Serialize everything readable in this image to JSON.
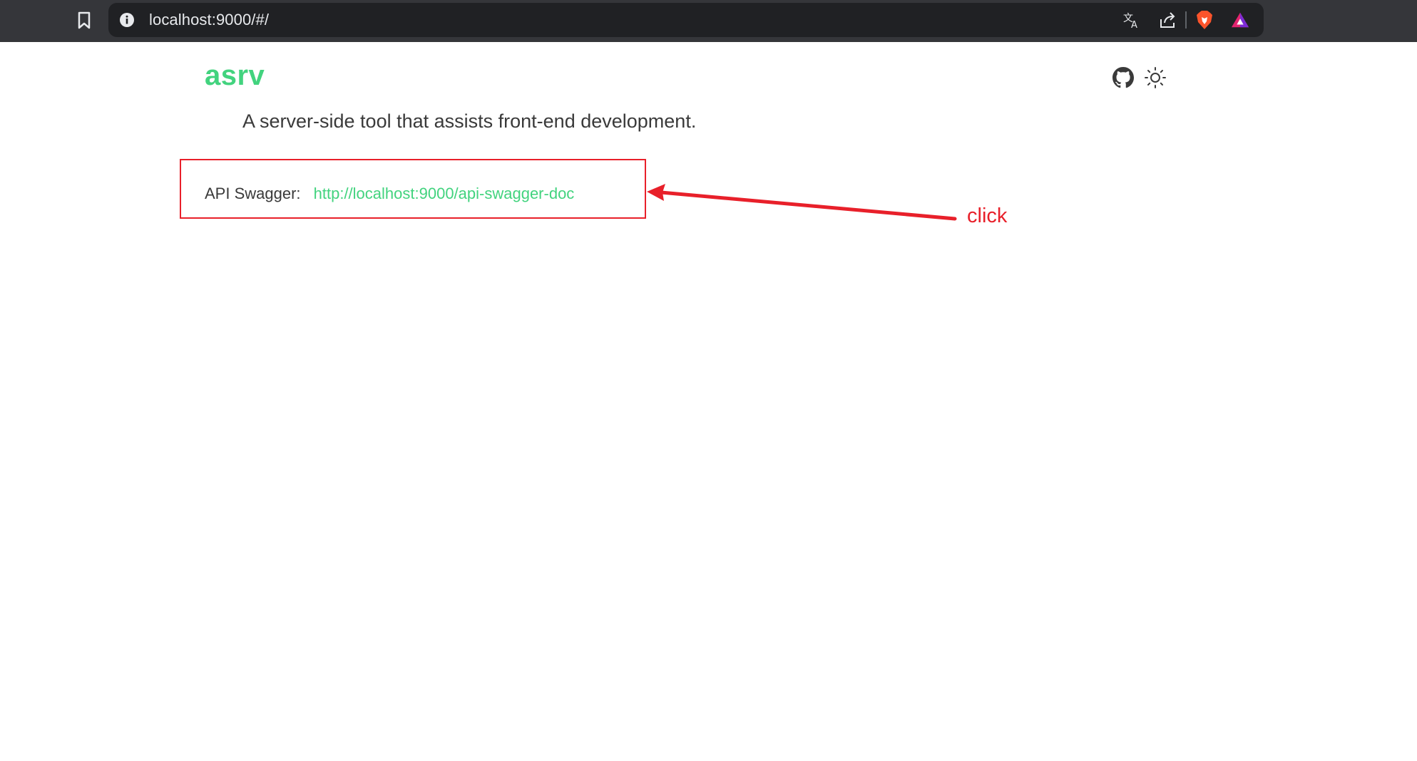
{
  "browser": {
    "url": "localhost:9000/#/",
    "icons": {
      "bookmark": "bookmark-icon",
      "info": "info-icon",
      "translate": "translate-icon",
      "share": "share-icon",
      "brave": "brave-shield-icon",
      "rewards": "brave-rewards-icon"
    }
  },
  "page": {
    "title": "asrv",
    "subtitle": "A server-side tool that assists front-end development.",
    "swagger_label": "API Swagger:",
    "swagger_link": "http://localhost:9000/api-swagger-doc",
    "header_icons": [
      "github-icon",
      "sun-icon"
    ]
  },
  "annotation": {
    "label": "click",
    "color": "#e8202a"
  },
  "colors": {
    "accent": "#42d37e",
    "toolbar": "#35363a",
    "addressbar": "#202124"
  }
}
